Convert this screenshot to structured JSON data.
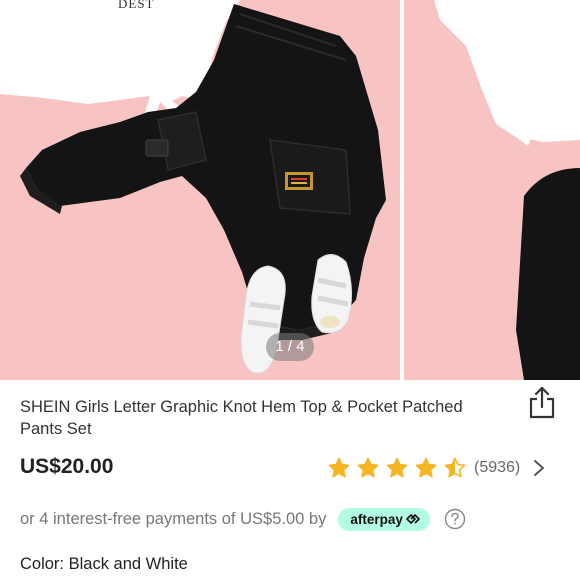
{
  "gallery": {
    "counter": "1 / 4",
    "current": 1,
    "total": 4
  },
  "product": {
    "title": "SHEIN Girls Letter Graphic Knot Hem Top & Pocket Patched Pants Set",
    "price": "US$20.00",
    "rating_stars": 4.5,
    "review_count": "(5936)",
    "installments_text": "or 4 interest-free payments of US$5.00 by",
    "afterpay_label": "afterpay",
    "color_label": "Color:",
    "color_value": "Black and White"
  },
  "colors": {
    "background_pink": "#f7c3c3",
    "star_gold": "#f5b625",
    "afterpay_mint": "#b2fce4"
  },
  "icons": [
    "share-icon",
    "star-icon",
    "chevron-right-icon",
    "afterpay-logo-icon",
    "help-circle-icon"
  ]
}
